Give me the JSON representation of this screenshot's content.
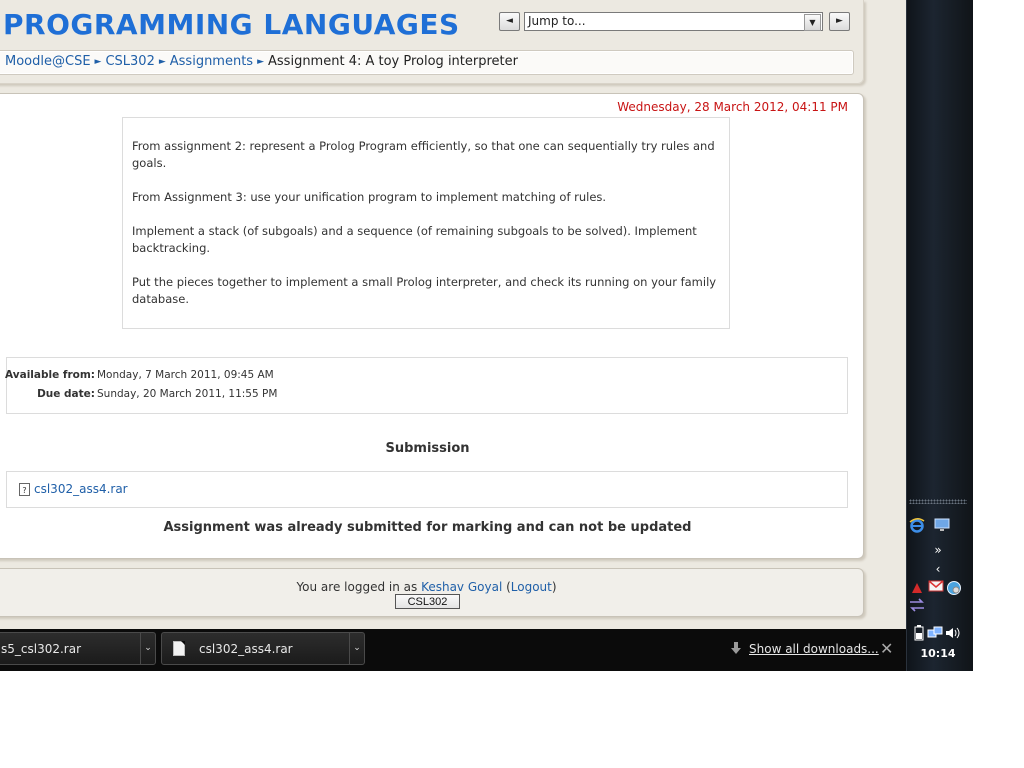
{
  "page": {
    "site_title": "PROGRAMMING LANGUAGES",
    "jump": {
      "prev_symbol": "◄",
      "next_symbol": "►",
      "selected": "Jump to...",
      "dropdown_symbol": "▼"
    },
    "breadcrumb": {
      "items": [
        "Moodle@CSE",
        "CSL302",
        "Assignments"
      ],
      "separator": "►",
      "current": "Assignment 4: A toy Prolog interpreter"
    },
    "date": "Wednesday, 28 March 2012, 04:11 PM",
    "description": [
      "From assignment 2: represent a Prolog Program efficiently, so that one can sequentially try rules and goals.",
      "From Assignment 3: use your unification program to implement matching of rules.",
      "Implement a stack (of subgoals) and a sequence (of remaining subgoals to be solved). Implement backtracking.",
      "Put the pieces together to implement a small Prolog interpreter, and check its running on your family database."
    ],
    "dates": {
      "available_label": "Available from:",
      "available_value": "Monday, 7 March 2011, 09:45 AM",
      "due_label": "Due date:",
      "due_value": "Sunday, 20 March 2011, 11:55 PM"
    },
    "submission_heading": "Submission",
    "submitted_file": {
      "icon_glyph": "?",
      "name": "csl302_ass4.rar"
    },
    "notice": "Assignment was already submitted for marking and can not be updated",
    "footer": {
      "prefix": "You are logged in as ",
      "user": "Keshav Goyal",
      "logout_open": " (",
      "logout": "Logout",
      "logout_close": ")",
      "course_button": "CSL302"
    }
  },
  "download_bar": {
    "items": [
      {
        "name": "s5_csl302.rar"
      },
      {
        "name": "csl302_ass4.rar"
      }
    ],
    "chevron": "⌄",
    "show_all": "Show all downloads...",
    "close": "✕"
  },
  "taskbar": {
    "clock": "10:14",
    "icons": [
      "internet-explorer",
      "show-desktop",
      "expand-chevrons",
      "collapse-tray",
      "pdf",
      "gmail",
      "network-globe",
      "swap",
      "battery",
      "network",
      "volume"
    ]
  },
  "colors": {
    "title_blue": "#1f6fd6",
    "link_blue": "#1f5fa8",
    "date_red": "#c81414",
    "page_bg": "#ece9e1"
  }
}
